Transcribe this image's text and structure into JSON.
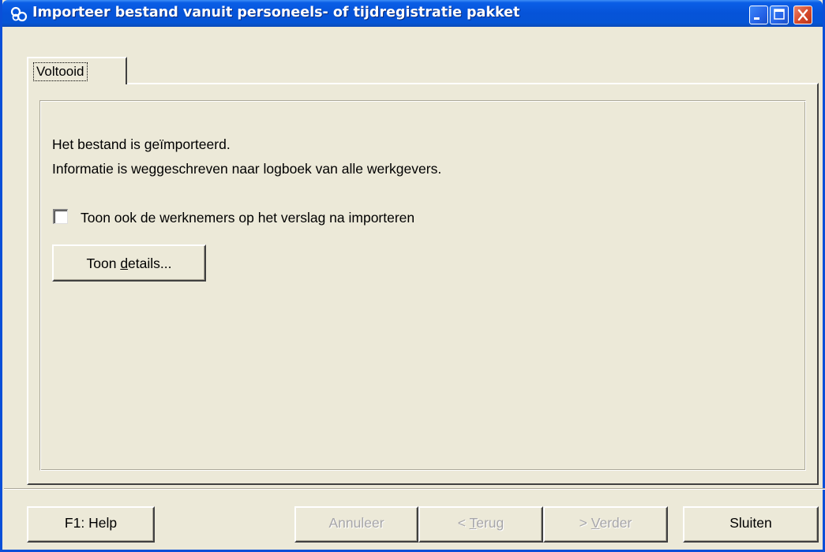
{
  "window": {
    "title": "Importeer bestand vanuit personeels- of tijdregistratie pakket",
    "titlebar_color": "#0653d8",
    "close_button_color": "#d64a2a"
  },
  "tabs": [
    {
      "label": "Voltooid",
      "selected": true
    }
  ],
  "content": {
    "message_line1": "Het bestand is geïmporteerd.",
    "message_line2": "Informatie is weggeschreven naar logboek van alle werkgevers.",
    "checkbox": {
      "label": "Toon ook de werknemers op het verslag na importeren",
      "checked": false
    },
    "details_button": {
      "before": "Toon ",
      "mnemonic": "d",
      "after": "etails..."
    }
  },
  "footer": {
    "help": "F1: Help",
    "cancel": "Annuleer",
    "back": {
      "before": "< ",
      "mnemonic": "T",
      "after": "erug"
    },
    "next": {
      "before": "> ",
      "mnemonic": "V",
      "after": "erder"
    },
    "close": "Sluiten",
    "disabled_text_color": "#a7a6aa"
  },
  "icons": [
    "app-logo-icon",
    "minimize-icon",
    "maximize-icon",
    "close-icon"
  ]
}
